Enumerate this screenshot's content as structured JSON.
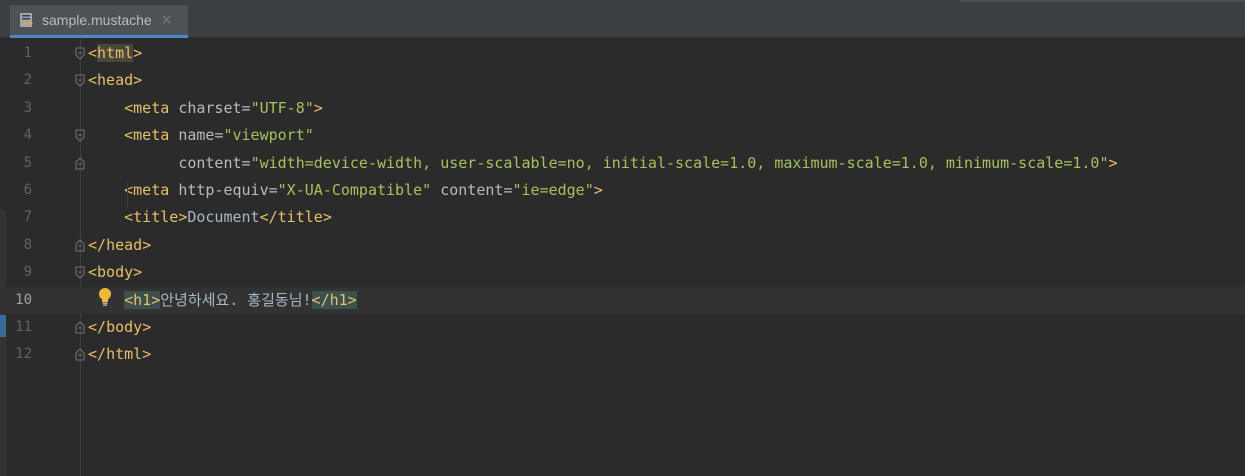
{
  "tab": {
    "filename": "sample.mustache",
    "close_symbol": "×",
    "icon": "mustache-file-icon"
  },
  "lines": [
    {
      "num": "1",
      "parts": [
        [
          "br",
          "<"
        ],
        [
          "tag",
          "html"
        ],
        [
          "br",
          ">"
        ]
      ]
    },
    {
      "num": "2",
      "parts": [
        [
          "br",
          "<"
        ],
        [
          "tag",
          "head"
        ],
        [
          "br",
          ">"
        ]
      ]
    },
    {
      "num": "3",
      "parts": [
        [
          "txt",
          "    "
        ],
        [
          "br",
          "<"
        ],
        [
          "tag",
          "meta"
        ],
        [
          "txt",
          " "
        ],
        [
          "attr",
          "charset"
        ],
        [
          "attr",
          "="
        ],
        [
          "val",
          "\"UTF-8\""
        ],
        [
          "br",
          ">"
        ]
      ]
    },
    {
      "num": "4",
      "parts": [
        [
          "txt",
          "    "
        ],
        [
          "br",
          "<"
        ],
        [
          "tag",
          "meta"
        ],
        [
          "txt",
          " "
        ],
        [
          "attr",
          "name"
        ],
        [
          "attr",
          "="
        ],
        [
          "val",
          "\"viewport\""
        ]
      ]
    },
    {
      "num": "5",
      "parts": [
        [
          "txt",
          "          "
        ],
        [
          "attr",
          "content"
        ],
        [
          "attr",
          "="
        ],
        [
          "val",
          "\"width=device-width, user-scalable=no, initial-scale=1.0, maximum-scale=1.0, minimum-scale=1.0\""
        ],
        [
          "br",
          ">"
        ]
      ]
    },
    {
      "num": "6",
      "parts": [
        [
          "txt",
          "    "
        ],
        [
          "br",
          "<"
        ],
        [
          "tag",
          "meta"
        ],
        [
          "txt",
          " "
        ],
        [
          "attr",
          "http-equiv"
        ],
        [
          "attr",
          "="
        ],
        [
          "val",
          "\"X-UA-Compatible\""
        ],
        [
          "txt",
          " "
        ],
        [
          "attr",
          "content"
        ],
        [
          "attr",
          "="
        ],
        [
          "val",
          "\"ie=edge\""
        ],
        [
          "br",
          ">"
        ]
      ]
    },
    {
      "num": "7",
      "parts": [
        [
          "txt",
          "    "
        ],
        [
          "br",
          "<"
        ],
        [
          "tag",
          "title"
        ],
        [
          "br",
          ">"
        ],
        [
          "txt",
          "Document"
        ],
        [
          "br",
          "</"
        ],
        [
          "tag",
          "title"
        ],
        [
          "br",
          ">"
        ]
      ]
    },
    {
      "num": "8",
      "parts": [
        [
          "br",
          "</"
        ],
        [
          "tag",
          "head"
        ],
        [
          "br",
          ">"
        ]
      ]
    },
    {
      "num": "9",
      "parts": [
        [
          "br",
          "<"
        ],
        [
          "tag",
          "body"
        ],
        [
          "br",
          ">"
        ]
      ]
    },
    {
      "num": "10",
      "parts": [
        [
          "txt",
          "    "
        ],
        [
          "br",
          "<"
        ],
        [
          "tag",
          "h1"
        ],
        [
          "br",
          ">"
        ],
        [
          "txt",
          "안녕하세요. 홍길동님!"
        ],
        [
          "br",
          "</"
        ],
        [
          "tag",
          "h1"
        ],
        [
          "br",
          ">"
        ]
      ]
    },
    {
      "num": "11",
      "parts": [
        [
          "br",
          "</"
        ],
        [
          "tag",
          "body"
        ],
        [
          "br",
          ">"
        ]
      ]
    },
    {
      "num": "12",
      "parts": [
        [
          "br",
          "</"
        ],
        [
          "tag",
          "html"
        ],
        [
          "br",
          ">"
        ]
      ]
    }
  ],
  "current_line": "10",
  "colors": {
    "background": "#2b2b2b",
    "tag": "#e8bf6a",
    "attribute": "#bababa",
    "value": "#a5c25c",
    "text": "#a9b7c6",
    "line_number": "#606366",
    "accent": "#4a88c7"
  }
}
